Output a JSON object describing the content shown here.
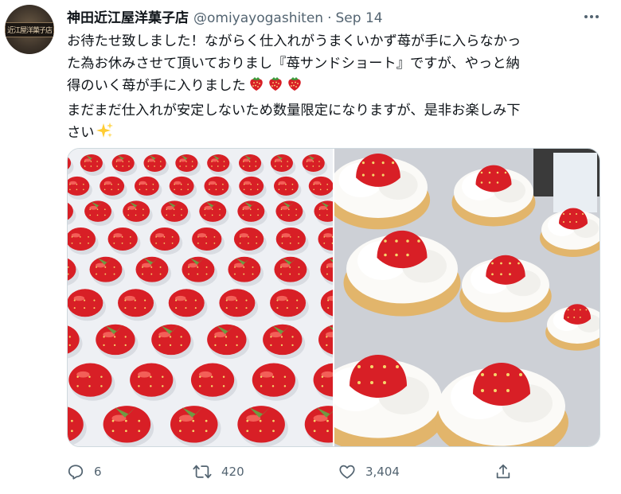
{
  "tweet": {
    "author_name": "神田近江屋洋菓子店",
    "handle": "@omiyayogashiten",
    "separator": "·",
    "date": "Sep 14",
    "avatar_text": "近江屋洋菓子店",
    "text_lines": [
      "お待たせ致しました！ながらく仕入れがうまくいかず苺が手に入らなかっ",
      "た為お休みさせて頂いておりまし『苺サンドショート』ですが、やっと納",
      "得のいく苺が手に入りました",
      "まだまだ仕入れが安定しないため数量限定になりますが、是非お楽しみ下",
      "さい"
    ],
    "images": [
      {
        "alt": "strawberries"
      },
      {
        "alt": "strawberry shortcakes"
      }
    ]
  },
  "actions": {
    "reply": {
      "icon": "reply-icon",
      "count": "6"
    },
    "retweet": {
      "icon": "retweet-icon",
      "count": "420"
    },
    "like": {
      "icon": "heart-icon",
      "count": "3,404"
    },
    "share": {
      "icon": "share-icon"
    }
  },
  "colors": {
    "text": "#0f1419",
    "secondary": "#536471",
    "strawberry": "#d81f26",
    "border": "#cfd9de"
  }
}
